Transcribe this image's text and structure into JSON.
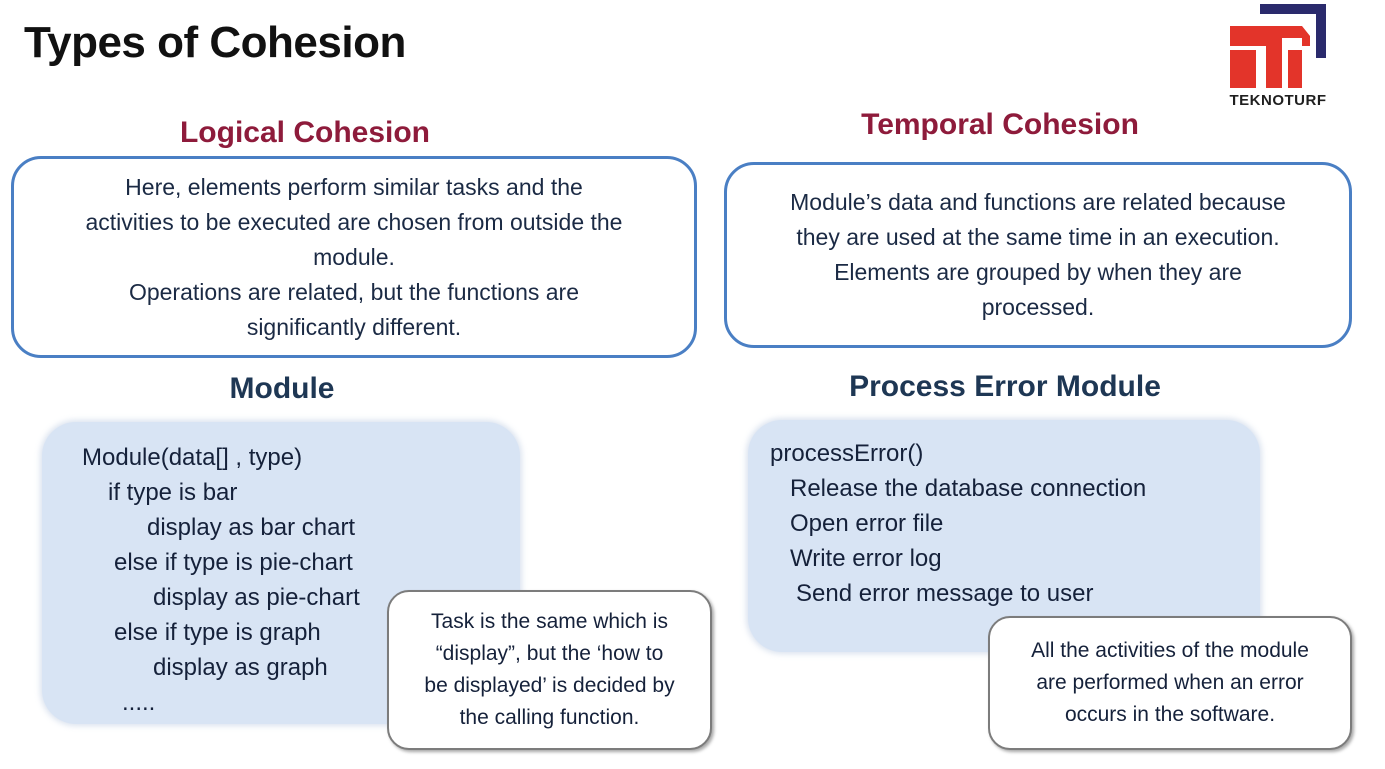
{
  "title": "Types of Cohesion",
  "logo": {
    "text": "TEKNOTURF",
    "colors": {
      "red": "#e3342a",
      "navy": "#2a2a6c"
    }
  },
  "logical": {
    "heading": "Logical Cohesion",
    "desc_lines": [
      "Here, elements perform similar tasks and the",
      "activities to be executed are chosen from outside the",
      "module.",
      "Operations are related, but the functions are",
      "significantly different."
    ],
    "example_heading": "Module",
    "code_lines": [
      "Module(data[] , type)",
      "if type is bar",
      "display as bar chart",
      "else if type is pie-chart",
      "display as pie-chart",
      "else if type is graph",
      "display as graph",
      "....."
    ],
    "note_lines": [
      "Task is the same which is",
      "“display”, but the ‘how to",
      "be displayed’ is decided by",
      "the calling function."
    ]
  },
  "temporal": {
    "heading": "Temporal Cohesion",
    "desc_lines": [
      "Module’s data and functions are related because",
      "they are used at the same time in an execution.",
      "Elements are grouped by when they are",
      "processed."
    ],
    "example_heading": "Process Error Module",
    "code_lines": [
      "processError()",
      "Release the database connection",
      "Open error file",
      "Write error log",
      "Send error message to user"
    ],
    "note_lines": [
      "All the activities of the module",
      "are performed when an error",
      "occurs in the software."
    ]
  },
  "colors": {
    "heading_maroon": "#8e1b3b",
    "heading_navy": "#1e3754",
    "box_border": "#4a7fc4",
    "code_bg": "#d8e4f4"
  }
}
